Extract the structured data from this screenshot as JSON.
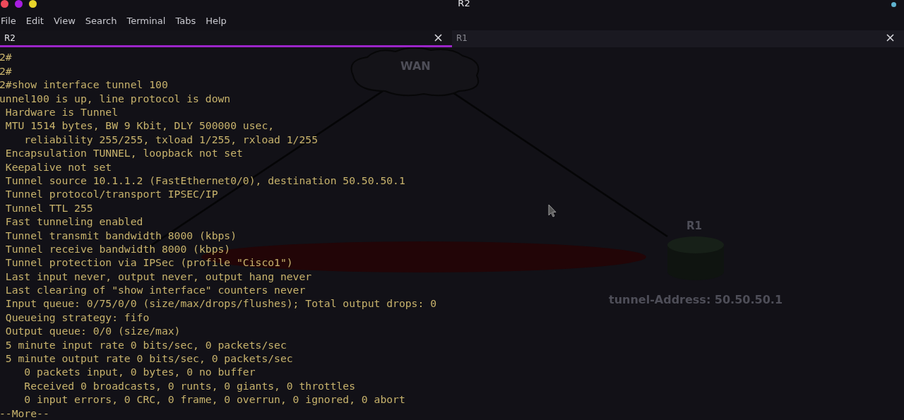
{
  "window": {
    "title": "R2"
  },
  "menu": [
    "File",
    "Edit",
    "View",
    "Search",
    "Terminal",
    "Tabs",
    "Help"
  ],
  "tabs": [
    {
      "label": "R2",
      "selected": true
    },
    {
      "label": "R1",
      "selected": false
    }
  ],
  "diagram": {
    "cloud_label": "WAN",
    "router_label": "R1",
    "address_label": "tunnel-Address: 50.50.50.1"
  },
  "terminal_lines": [
    "2#",
    "2#",
    "2#show interface tunnel 100",
    "unnel100 is up, line protocol is down",
    " Hardware is Tunnel",
    " MTU 1514 bytes, BW 9 Kbit, DLY 500000 usec,",
    "    reliability 255/255, txload 1/255, rxload 1/255",
    " Encapsulation TUNNEL, loopback not set",
    " Keepalive not set",
    " Tunnel source 10.1.1.2 (FastEthernet0/0), destination 50.50.50.1",
    " Tunnel protocol/transport IPSEC/IP",
    " Tunnel TTL 255",
    " Fast tunneling enabled",
    " Tunnel transmit bandwidth 8000 (kbps)",
    " Tunnel receive bandwidth 8000 (kbps)",
    " Tunnel protection via IPSec (profile \"Cisco1\")",
    " Last input never, output never, output hang never",
    " Last clearing of \"show interface\" counters never",
    " Input queue: 0/75/0/0 (size/max/drops/flushes); Total output drops: 0",
    " Queueing strategy: fifo",
    " Output queue: 0/0 (size/max)",
    " 5 minute input rate 0 bits/sec, 0 packets/sec",
    " 5 minute output rate 0 bits/sec, 0 packets/sec",
    "    0 packets input, 0 bytes, 0 no buffer",
    "    Received 0 broadcasts, 0 runts, 0 giants, 0 throttles",
    "    0 input errors, 0 CRC, 0 frame, 0 overrun, 0 ignored, 0 abort",
    "--More--"
  ]
}
